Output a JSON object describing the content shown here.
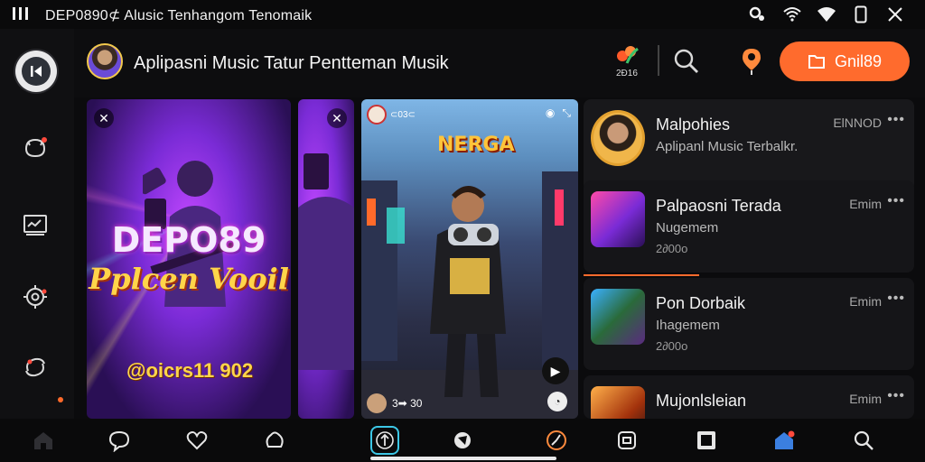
{
  "status_bar": {
    "title": "DEP0890⊄ Alusic Tenhangom Tenomaik",
    "icons": [
      "key-icon",
      "wifi-icon",
      "signal-icon",
      "phone-icon",
      "close-icon"
    ]
  },
  "rail": {
    "items": [
      "back-icon",
      "notification-icon",
      "monitor-icon",
      "settings-icon",
      "sync-icon"
    ]
  },
  "header": {
    "title": "Aplipasni Music Tatur Pentteman Musik",
    "brand_count": "2Ð16",
    "primary_button": "Gnil89",
    "accent_color": "#ff6b2d"
  },
  "posters": {
    "a": {
      "title": "DEPO89",
      "subtitle": "Pplcen Vooil",
      "tag": "@oicrs11 902"
    },
    "b": {
      "logo": "NERGA",
      "top_label": "⊂03⊂",
      "bottom_label": "3➡ 30"
    }
  },
  "list": {
    "items": [
      {
        "title": "Malpohies",
        "subtitle": "Aplipanl Music Terbalkr.",
        "meta": "",
        "right": "ElNNOD"
      },
      {
        "title": "Palpaosni Terada",
        "subtitle": "Nugemem",
        "meta": "2∂00o",
        "right": "Emim"
      },
      {
        "title": "Pon Dorbaik",
        "subtitle": "Ihagemem",
        "meta": "2∂00o",
        "right": "Emim"
      },
      {
        "title": "Mujonlsleian",
        "subtitle": "",
        "meta": "",
        "right": "Emim"
      }
    ]
  },
  "bottom_nav": {
    "items": [
      "home-icon",
      "chat-icon",
      "heart-icon",
      "explore-icon",
      "upload-icon",
      "discover-icon",
      "timer-icon",
      "save-icon",
      "library-icon",
      "home-active-icon",
      "search-icon"
    ]
  }
}
